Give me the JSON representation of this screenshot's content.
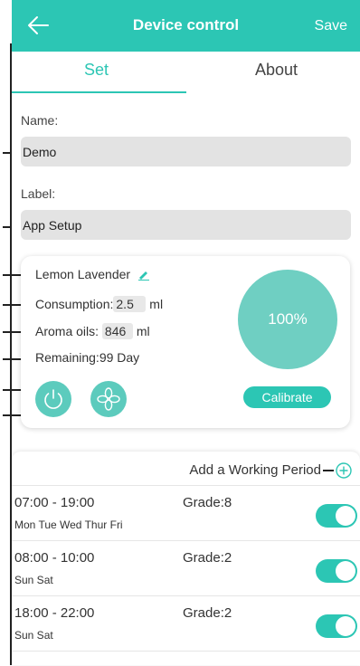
{
  "header": {
    "title": "Device control",
    "save_label": "Save",
    "back_icon": "back-arrow-icon"
  },
  "tabs": [
    {
      "label": "Set",
      "active": true
    },
    {
      "label": "About",
      "active": false
    }
  ],
  "form": {
    "name_label": "Name:",
    "name_value": "Demo",
    "label_label": "Label:",
    "label_value": "App Setup"
  },
  "device": {
    "scent": "Lemon Lavender",
    "consumption_label": "Consumption:",
    "consumption_value": "2.5",
    "consumption_unit": "ml",
    "aroma_label": "Aroma oils:",
    "aroma_value": "846",
    "aroma_unit": "ml",
    "remaining": "Remaining:99 Day",
    "level_text": "100%",
    "level_fraction": 1.0,
    "calibrate_label": "Calibrate",
    "power_icon": "power-icon",
    "fan_icon": "fan-icon"
  },
  "periods": {
    "add_label": "Add a Working Period",
    "items": [
      {
        "time": "07:00 - 19:00",
        "days": "Mon Tue Wed Thur Fri",
        "grade": "Grade:8",
        "enabled": true
      },
      {
        "time": "08:00 - 10:00",
        "days": "Sun Sat",
        "grade": "Grade:2",
        "enabled": true
      },
      {
        "time": "18:00 - 22:00",
        "days": "Sun Sat",
        "grade": "Grade:2",
        "enabled": true
      }
    ]
  },
  "colors": {
    "accent": "#2cc6b4",
    "gauge": "#6fcfc2",
    "field_bg": "#e3e3e3"
  }
}
